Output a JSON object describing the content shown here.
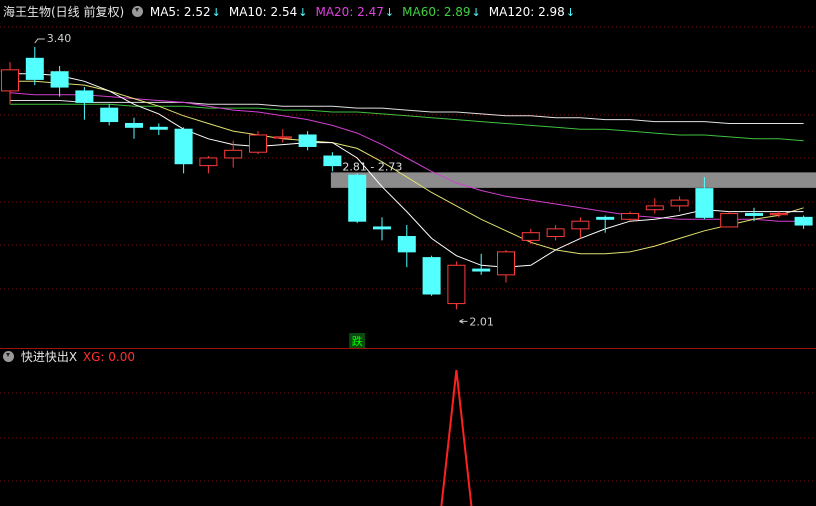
{
  "main_header": {
    "title": "海王生物(日线 前复权)",
    "ma": [
      {
        "label": "MA5: 2.52",
        "arrow": "↓",
        "color": "#ffffff"
      },
      {
        "label": "MA10: 2.54",
        "arrow": "↓",
        "color": "#ffffff"
      },
      {
        "label": "MA20: 2.47",
        "arrow": "↓",
        "color": "#e040e0"
      },
      {
        "label": "MA60: 2.89",
        "arrow": "↓",
        "color": "#40d040"
      },
      {
        "label": "MA120: 2.98",
        "arrow": "↓",
        "color": "#ffffff"
      }
    ]
  },
  "sub_header": {
    "title": "快进快出X",
    "xg_label": "XG: 0.00"
  },
  "colors": {
    "up": "#ff3b3b",
    "down": "#54ffff",
    "ma5": "#ffffff",
    "ma10": "#e0e070",
    "ma20": "#d040d0",
    "ma60": "#40c040",
    "ma120": "#e0e0e0",
    "band": "#8c8c8c",
    "xg": "#ff2020",
    "badge_text": "#00ff00"
  },
  "chart_data": {
    "type": "candlestick",
    "ylim": [
      1.85,
      3.52
    ],
    "candles": [
      {
        "o": 3.15,
        "c": 3.26,
        "h": 3.3,
        "l": 3.08
      },
      {
        "o": 3.32,
        "c": 3.21,
        "h": 3.38,
        "l": 3.18
      },
      {
        "o": 3.25,
        "c": 3.17,
        "h": 3.28,
        "l": 3.12
      },
      {
        "o": 3.15,
        "c": 3.09,
        "h": 3.17,
        "l": 3.0
      },
      {
        "o": 3.06,
        "c": 2.99,
        "h": 3.08,
        "l": 2.97
      },
      {
        "o": 2.98,
        "c": 2.96,
        "h": 3.01,
        "l": 2.9
      },
      {
        "o": 2.96,
        "c": 2.95,
        "h": 2.98,
        "l": 2.92
      },
      {
        "o": 2.95,
        "c": 2.77,
        "h": 2.96,
        "l": 2.72
      },
      {
        "o": 2.76,
        "c": 2.8,
        "h": 2.81,
        "l": 2.72
      },
      {
        "o": 2.8,
        "c": 2.84,
        "h": 2.89,
        "l": 2.75
      },
      {
        "o": 2.83,
        "c": 2.92,
        "h": 2.94,
        "l": 2.82
      },
      {
        "o": 2.91,
        "c": 2.91,
        "h": 2.95,
        "l": 2.88
      },
      {
        "o": 2.92,
        "c": 2.86,
        "h": 2.94,
        "l": 2.84
      },
      {
        "o": 2.81,
        "c": 2.76,
        "h": 2.83,
        "l": 2.73
      },
      {
        "o": 2.71,
        "c": 2.47,
        "h": 2.72,
        "l": 2.46
      },
      {
        "o": 2.44,
        "c": 2.43,
        "h": 2.49,
        "l": 2.37
      },
      {
        "o": 2.39,
        "c": 2.31,
        "h": 2.45,
        "l": 2.23
      },
      {
        "o": 2.28,
        "c": 2.09,
        "h": 2.29,
        "l": 2.08
      },
      {
        "o": 2.04,
        "c": 2.24,
        "h": 2.26,
        "l": 2.01
      },
      {
        "o": 2.22,
        "c": 2.21,
        "h": 2.3,
        "l": 2.19
      },
      {
        "o": 2.19,
        "c": 2.31,
        "h": 2.32,
        "l": 2.15
      },
      {
        "o": 2.37,
        "c": 2.41,
        "h": 2.43,
        "l": 2.35
      },
      {
        "o": 2.39,
        "c": 2.43,
        "h": 2.45,
        "l": 2.37
      },
      {
        "o": 2.43,
        "c": 2.47,
        "h": 2.49,
        "l": 2.38
      },
      {
        "o": 2.49,
        "c": 2.48,
        "h": 2.5,
        "l": 2.41
      },
      {
        "o": 2.48,
        "c": 2.51,
        "h": 2.52,
        "l": 2.47
      },
      {
        "o": 2.53,
        "c": 2.55,
        "h": 2.59,
        "l": 2.51
      },
      {
        "o": 2.55,
        "c": 2.58,
        "h": 2.6,
        "l": 2.52
      },
      {
        "o": 2.64,
        "c": 2.49,
        "h": 2.7,
        "l": 2.48
      },
      {
        "o": 2.44,
        "c": 2.51,
        "h": 2.52,
        "l": 2.44
      },
      {
        "o": 2.51,
        "c": 2.5,
        "h": 2.54,
        "l": 2.47
      },
      {
        "o": 2.51,
        "c": 2.51,
        "h": 2.52,
        "l": 2.49
      },
      {
        "o": 2.49,
        "c": 2.45,
        "h": 2.5,
        "l": 2.43
      }
    ],
    "ma5": [
      3.24,
      3.24,
      3.23,
      3.2,
      3.15,
      3.08,
      3.03,
      2.95,
      2.9,
      2.87,
      2.86,
      2.87,
      2.88,
      2.88,
      2.8,
      2.65,
      2.52,
      2.38,
      2.29,
      2.24,
      2.23,
      2.24,
      2.32,
      2.38,
      2.43,
      2.47,
      2.48,
      2.5,
      2.53,
      2.52,
      2.52,
      2.52,
      2.52
    ],
    "ma10": [
      3.2,
      3.2,
      3.19,
      3.18,
      3.15,
      3.11,
      3.07,
      3.02,
      2.98,
      2.94,
      2.92,
      2.9,
      2.89,
      2.88,
      2.85,
      2.78,
      2.7,
      2.62,
      2.55,
      2.48,
      2.42,
      2.36,
      2.32,
      2.3,
      2.3,
      2.31,
      2.34,
      2.38,
      2.42,
      2.45,
      2.48,
      2.5,
      2.54
    ],
    "ma20": [
      3.14,
      3.13,
      3.13,
      3.13,
      3.12,
      3.11,
      3.1,
      3.09,
      3.07,
      3.05,
      3.04,
      3.02,
      3.0,
      2.97,
      2.93,
      2.87,
      2.8,
      2.73,
      2.67,
      2.63,
      2.6,
      2.58,
      2.56,
      2.54,
      2.52,
      2.5,
      2.49,
      2.48,
      2.48,
      2.48,
      2.48,
      2.47,
      2.47
    ],
    "ma60": [
      3.08,
      3.08,
      3.08,
      3.08,
      3.08,
      3.07,
      3.07,
      3.07,
      3.06,
      3.06,
      3.06,
      3.05,
      3.05,
      3.04,
      3.04,
      3.03,
      3.02,
      3.01,
      3.0,
      2.99,
      2.98,
      2.97,
      2.96,
      2.95,
      2.95,
      2.94,
      2.93,
      2.92,
      2.92,
      2.91,
      2.9,
      2.9,
      2.89
    ],
    "ma120": [
      3.1,
      3.1,
      3.1,
      3.09,
      3.09,
      3.09,
      3.09,
      3.09,
      3.08,
      3.08,
      3.08,
      3.07,
      3.07,
      3.07,
      3.06,
      3.06,
      3.05,
      3.04,
      3.04,
      3.03,
      3.02,
      3.02,
      3.01,
      3.01,
      3.0,
      3.0,
      2.99,
      2.99,
      2.99,
      2.98,
      2.98,
      2.98,
      2.98
    ],
    "band": {
      "from": 2.73,
      "to": 2.67,
      "start_index": 13
    },
    "annotations": {
      "high": {
        "text": "3.40",
        "index": 1,
        "value": 3.4
      },
      "low": {
        "text": "2.01",
        "index": 18,
        "value": 2.01
      },
      "band_label": {
        "text": "2.81 - 2.73",
        "index": 13
      },
      "badge": {
        "text": "跌",
        "index": 14
      }
    },
    "xg_signal": {
      "index": 18,
      "value": 1
    }
  }
}
